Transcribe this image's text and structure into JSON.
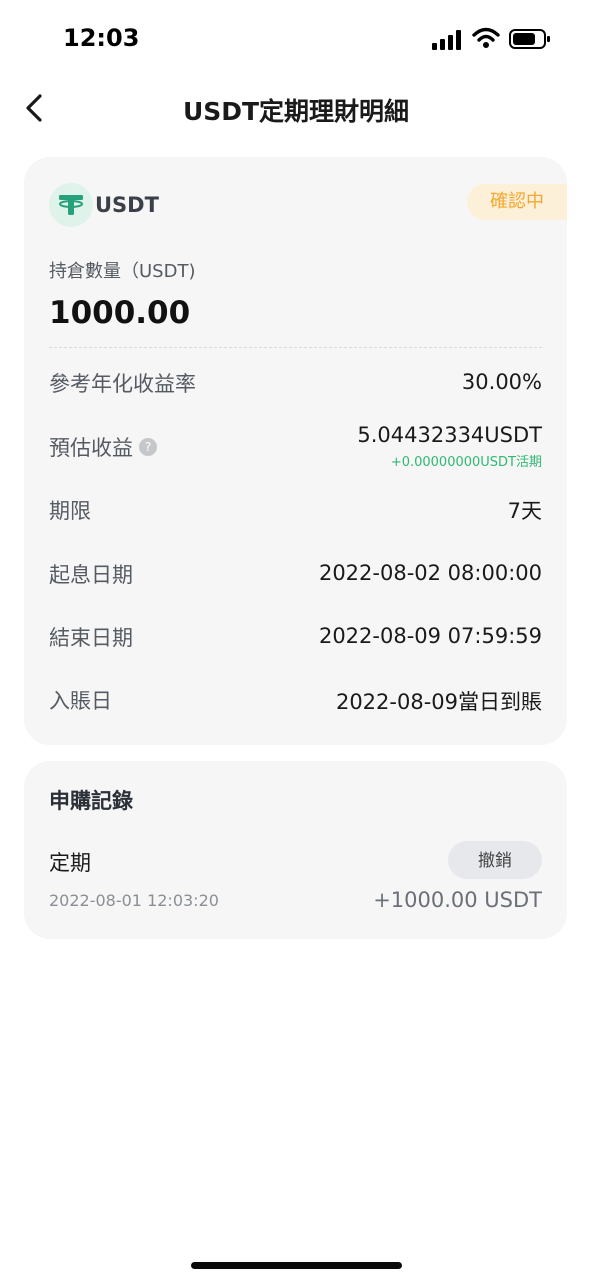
{
  "status_bar": {
    "time": "12:03"
  },
  "header": {
    "title": "USDT定期理財明細"
  },
  "detail": {
    "coin": "USDT",
    "status": "確認中",
    "holding_label": "持倉數量（USDT)",
    "holding_value": "1000.00",
    "rows": [
      {
        "label": "參考年化收益率",
        "value": "30.00%"
      },
      {
        "label": "預估收益",
        "value": "5.04432334USDT",
        "sub_value": "+0.00000000USDT活期",
        "help_icon": "question-icon"
      },
      {
        "label": "期限",
        "value": "7天"
      },
      {
        "label": "起息日期",
        "value": "2022-08-02 08:00:00"
      },
      {
        "label": "結束日期",
        "value": "2022-08-09 07:59:59"
      },
      {
        "label": "入賬日",
        "value": "2022-08-09當日到賬"
      }
    ]
  },
  "records": {
    "title": "申購記錄",
    "items": [
      {
        "type": "定期",
        "action": "撤銷",
        "time": "2022-08-01 12:03:20",
        "amount": "+1000.00 USDT"
      }
    ]
  },
  "colors": {
    "accent_green": "#2fb872",
    "status_orange": "#f2a82f",
    "status_bg": "#fdf0d8",
    "card_bg": "#f6f6f6"
  }
}
